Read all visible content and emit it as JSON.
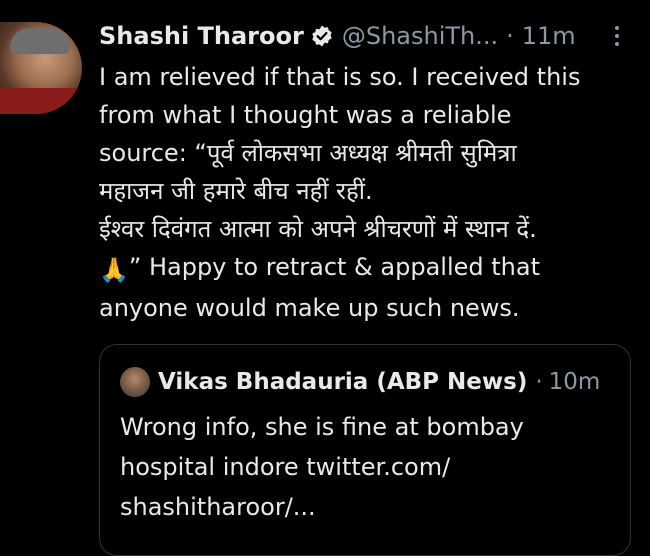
{
  "colors": {
    "background": "#000000",
    "text_primary": "#e7e9ea",
    "text_secondary": "#8b98a5",
    "border": "#2f3336",
    "verified_badge": "#e7e9ea"
  },
  "tweet": {
    "author": {
      "display_name": "Shashi Tharoor",
      "handle": "@ShashiTh...",
      "verified_icon": "verified-badge-icon"
    },
    "separator": "·",
    "time": "11m",
    "more_icon": "more-vertical-icon",
    "body_lines": [
      "I am relieved if that is so. I received this",
      "from what I thought was a reliable",
      "source: “पूर्व लोकसभा अध्यक्ष श्रीमती सुमित्रा",
      "महाजन जी हमारे बीच नहीं रहीं.",
      "ईश्वर दिवंगत आत्मा को अपने श्रीचरणों में स्थान दें."
    ],
    "body_emoji": "🙏",
    "body_emoji_icon": "folded-hands-icon",
    "body_line_after_emoji": "” Happy to retract & appalled that",
    "body_last_line": "anyone would make up such news."
  },
  "quoted_tweet": {
    "display_name": "Vikas Bhadauria (ABP News)",
    "separator": "·",
    "time": "10m",
    "text_lines": [
      "Wrong info, she is fine at bombay",
      "hospital indore twitter.com/",
      "shashitharoor/..."
    ]
  }
}
